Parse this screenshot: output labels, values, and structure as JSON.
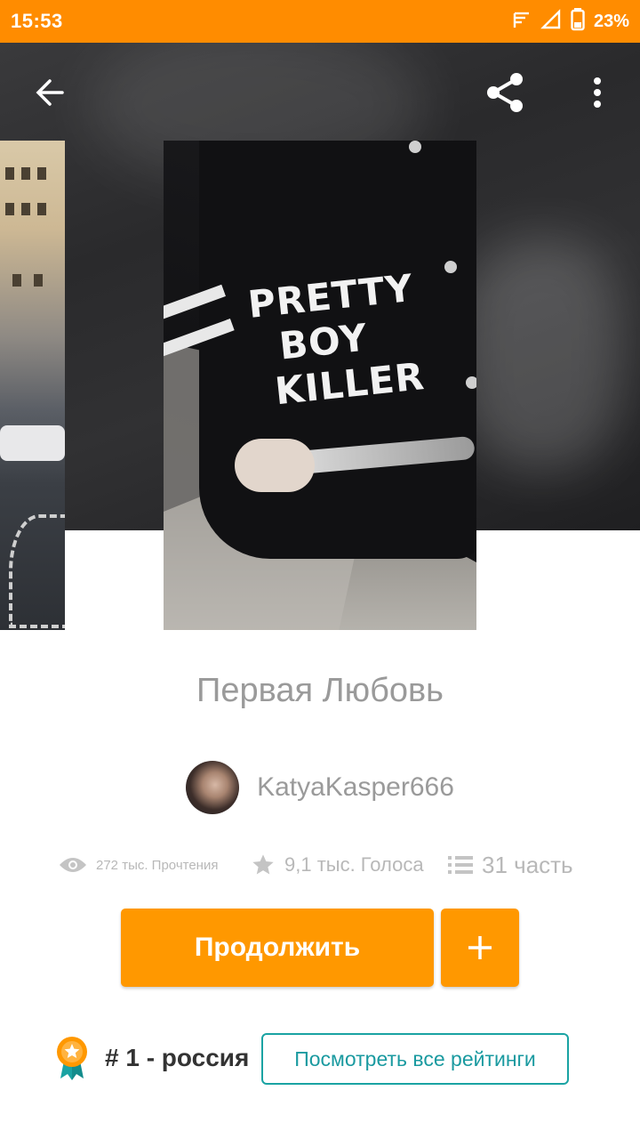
{
  "status": {
    "time": "15:53",
    "battery": "23%"
  },
  "story": {
    "title": "Первая Любовь",
    "author": "KatyaKasper666",
    "cover_text": [
      "PRETTY",
      "BOY",
      "KILLER"
    ]
  },
  "stats": {
    "reads": "272 тыс. Прочтения",
    "votes": "9,1 тыс. Голоса",
    "parts": "31 часть"
  },
  "actions": {
    "continue_label": "Продолжить",
    "add_label": "+"
  },
  "ranking": {
    "label": "# 1 - россия",
    "view_all_label": "Посмотреть все рейтинги"
  },
  "colors": {
    "accent": "#ff9800",
    "statusbar": "#ff8c00",
    "teal": "#1aa3a3"
  },
  "icons": [
    "back-arrow-icon",
    "share-icon",
    "more-vert-icon",
    "eye-icon",
    "star-icon",
    "list-icon",
    "medal-icon",
    "signal-icon",
    "battery-icon",
    "notification-icon"
  ]
}
